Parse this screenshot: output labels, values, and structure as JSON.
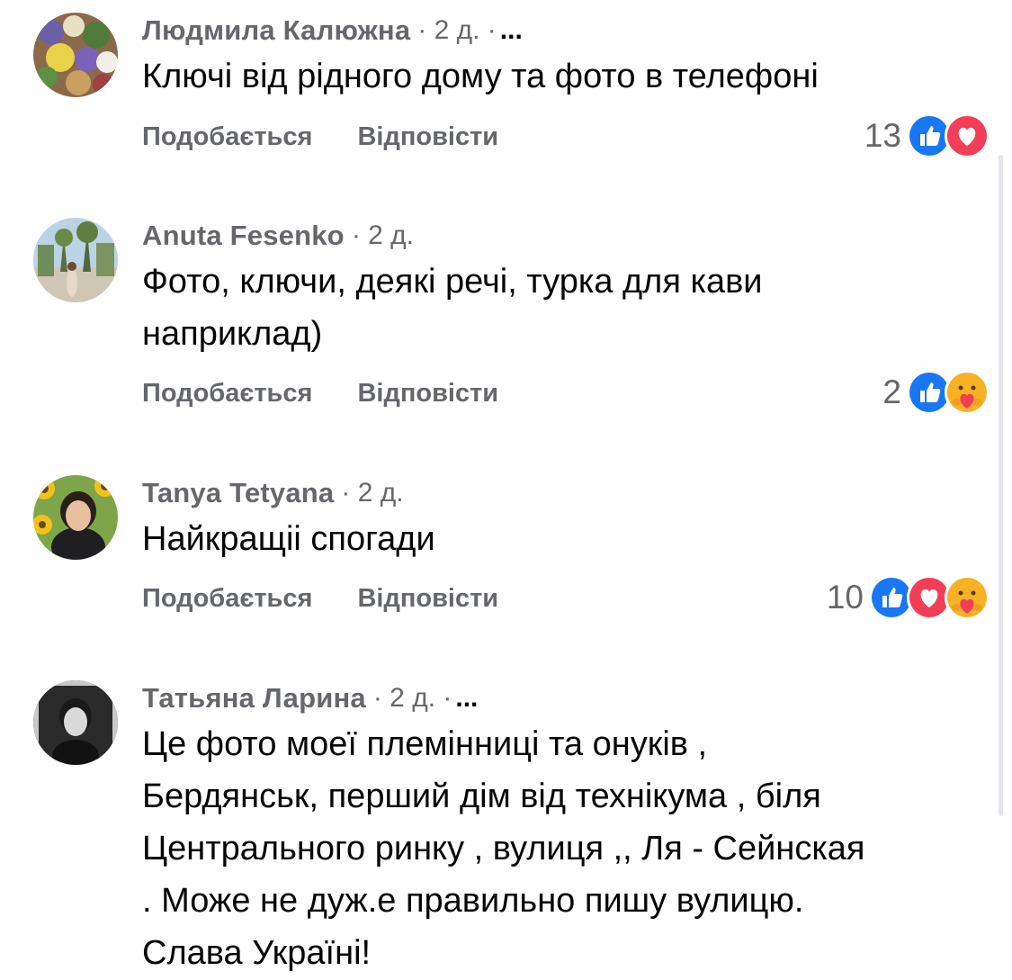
{
  "comments": [
    {
      "author": "Людмила Калюжна",
      "meta": "· 2 д. ·",
      "more": "...",
      "text": "Ключі від рідного дому та фото в телефоні",
      "like_label": "Подобається",
      "reply_label": "Відповісти",
      "reaction_count": "13",
      "reactions": [
        "like-icon",
        "love-icon"
      ]
    },
    {
      "author": "Anuta Fesenko",
      "meta": "· 2 д.",
      "text": "Фото, ключи, деякі речі, турка для кави\nнаприклад)",
      "like_label": "Подобається",
      "reply_label": "Відповісти",
      "reaction_count": "2",
      "reactions": [
        "like-icon",
        "care-icon"
      ]
    },
    {
      "author": "Tanya Tetyana",
      "meta": "· 2 д.",
      "text": "Найкращіі спогади",
      "like_label": "Подобається",
      "reply_label": "Відповісти",
      "reaction_count": "10",
      "reactions": [
        "like-icon",
        "love-icon",
        "care-icon"
      ]
    },
    {
      "author": "Татьяна Ларина",
      "meta": "· 2 д. ·",
      "more": "...",
      "text": "Це фото моеї племінниці та онуків ,\nБердянськ, перший дім від технікума , біля\nЦентрального ринку , вулиця ,, Ля - Сейнская\n. Може не дуж.е правильно пишу вулицю.\nСлава Україні!"
    }
  ],
  "colors": {
    "like_blue": "#1877f2",
    "love_red": "#f33e58",
    "care_yellow": "#f7b125",
    "secondary_text": "#65676b",
    "primary_text": "#050505"
  }
}
